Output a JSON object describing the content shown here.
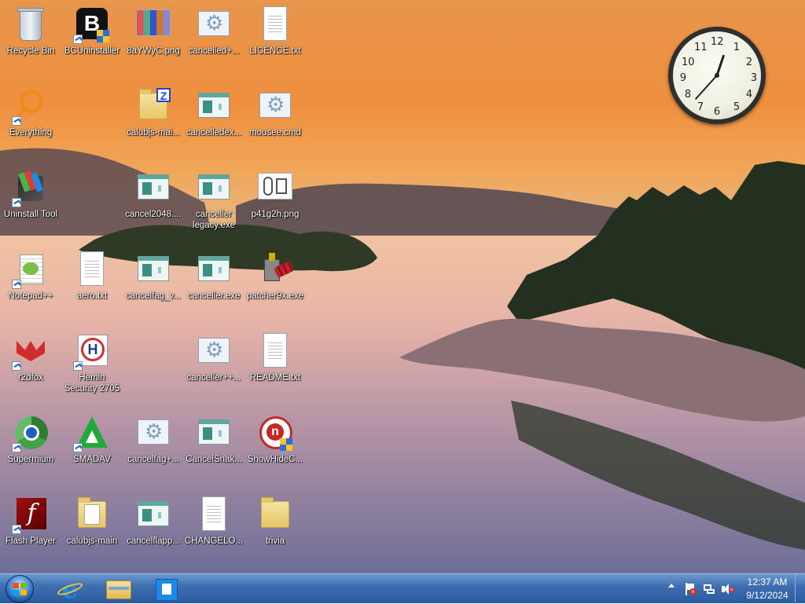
{
  "desktop": {
    "icons": [
      {
        "id": "recycle-bin",
        "label": "Recycle Bin"
      },
      {
        "id": "bcuninstaller",
        "label": "BCUninstaller"
      },
      {
        "id": "8aywyc-png",
        "label": "8aYWyC.png"
      },
      {
        "id": "cancelled-plus",
        "label": "cancelled+..."
      },
      {
        "id": "licence-txt",
        "label": "LICENCE.txt"
      },
      {
        "id": "everything",
        "label": "Everything"
      },
      {
        "id": "calubjs-main-zip",
        "label": "calubjs-mai..."
      },
      {
        "id": "cancelledex",
        "label": "cancelledex..."
      },
      {
        "id": "mousee-cmd",
        "label": "mousee.cmd"
      },
      {
        "id": "uninstall-tool",
        "label": "Uninstall Tool"
      },
      {
        "id": "cancel2048",
        "label": "cancel2048...."
      },
      {
        "id": "canceller-legacy",
        "label": "canceller legacy.exe"
      },
      {
        "id": "p41g2h-png",
        "label": "p41g2h.png"
      },
      {
        "id": "notepad-plus-plus",
        "label": "Notepad++"
      },
      {
        "id": "aero-txt",
        "label": "aero.txt"
      },
      {
        "id": "cancelfag-v",
        "label": "cancelfag_v..."
      },
      {
        "id": "canceller-exe",
        "label": "canceller.exe"
      },
      {
        "id": "patcher9x-exe",
        "label": "patcher9x.exe"
      },
      {
        "id": "r2dfox",
        "label": "r2dfox"
      },
      {
        "id": "hemin-security",
        "label": "Hemin Security 2705"
      },
      {
        "id": "canceller-plus-plus",
        "label": "canceller++..."
      },
      {
        "id": "readme-txt",
        "label": "README.txt"
      },
      {
        "id": "supermium",
        "label": "Supermium"
      },
      {
        "id": "smadav",
        "label": "SMADAV"
      },
      {
        "id": "cancelfag-plus",
        "label": "cancelfag+..."
      },
      {
        "id": "cancelsnak",
        "label": "CancelSnak..."
      },
      {
        "id": "showhidec",
        "label": "ShowHideC..."
      },
      {
        "id": "flash-player",
        "label": "Flash Player"
      },
      {
        "id": "calubjs-main",
        "label": "calubjs-main"
      },
      {
        "id": "cancelflapp",
        "label": "cancelflapp..."
      },
      {
        "id": "changelog",
        "label": "CHANGELO..."
      },
      {
        "id": "trivia",
        "label": "trivia"
      }
    ]
  },
  "gadgets": {
    "clock": {
      "numbers": [
        "12",
        "1",
        "2",
        "3",
        "4",
        "5",
        "6",
        "7",
        "8",
        "9",
        "10",
        "11"
      ],
      "time": "12:37"
    }
  },
  "taskbar": {
    "pinned": [
      {
        "name": "internet-explorer"
      },
      {
        "name": "file-explorer"
      },
      {
        "name": "windows-store"
      }
    ],
    "tray": {
      "time": "12:37 AM",
      "date": "9/12/2024"
    }
  },
  "colors": {
    "taskbar": "#2a5aa0",
    "sky": "#ef8f3e",
    "water": "#7a78a0"
  }
}
